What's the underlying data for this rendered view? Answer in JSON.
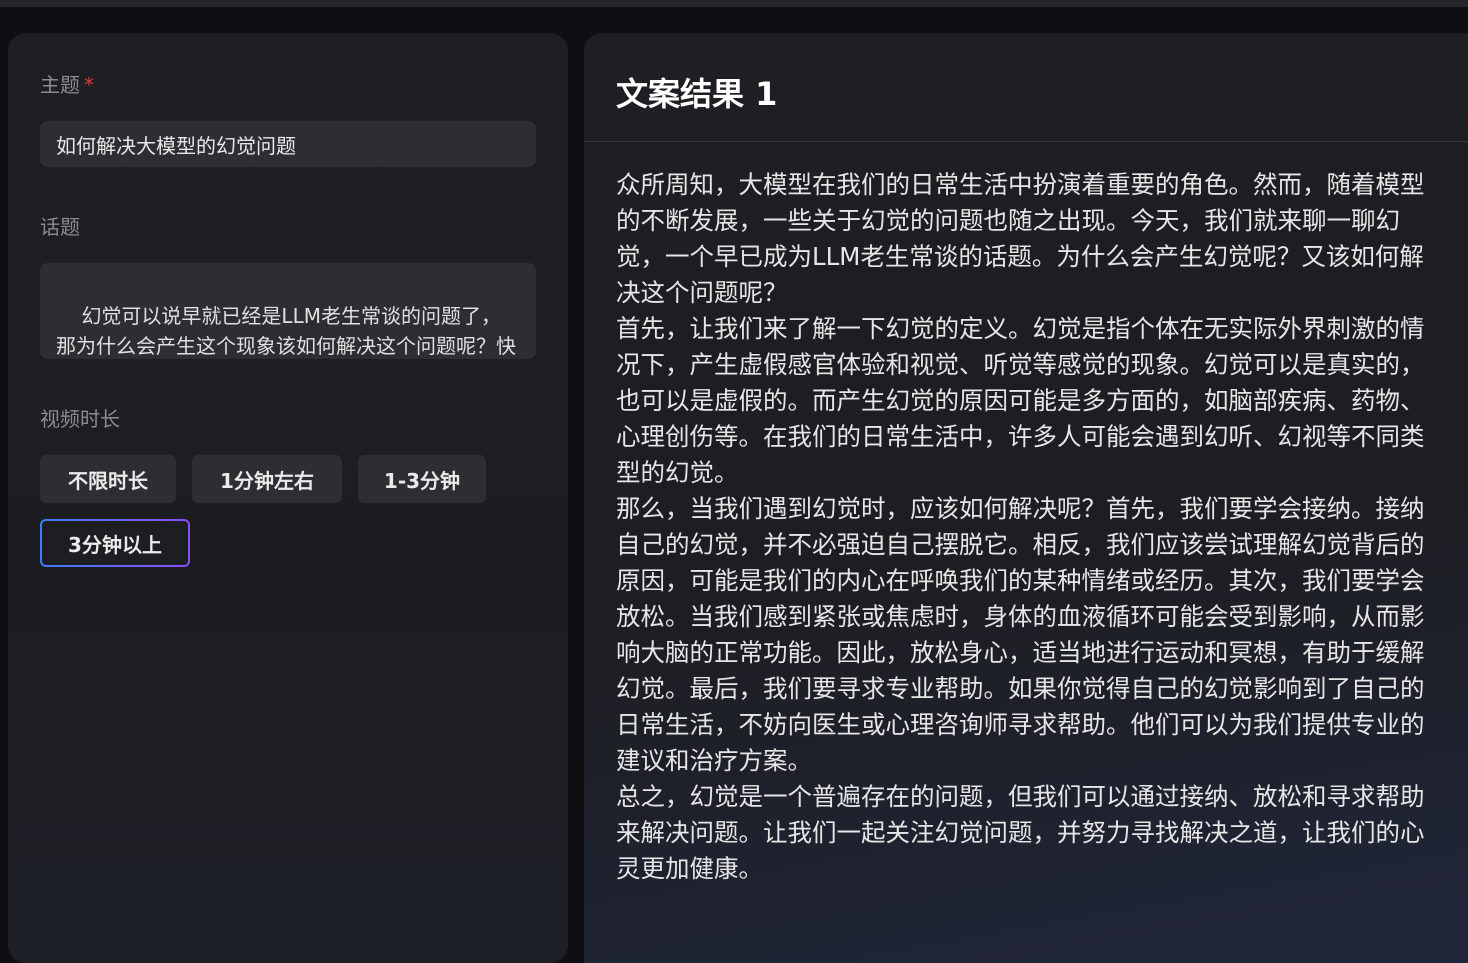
{
  "form": {
    "topic_label": "主题",
    "required_mark": "*",
    "topic_value": "如何解决大模型的幻觉问题",
    "subject_label": "话题",
    "subject_value": "幻觉可以说早就已经是LLM老生常谈的问题了，那为什么会产生这个现象该如何解决这个问题呢？快来和我们分享一下吧~",
    "duration_label": "视频时长",
    "duration_options": [
      "不限时长",
      "1分钟左右",
      "1-3分钟",
      "3分钟以上"
    ],
    "duration_selected": "3分钟以上"
  },
  "result": {
    "title": "文案结果 1",
    "paragraphs": [
      "众所周知，大模型在我们的日常生活中扮演着重要的角色。然而，随着模型的不断发展，一些关于幻觉的问题也随之出现。今天，我们就来聊一聊幻觉，一个早已成为LLM老生常谈的话题。为什么会产生幻觉呢？又该如何解决这个问题呢？",
      "首先，让我们来了解一下幻觉的定义。幻觉是指个体在无实际外界刺激的情况下，产生虚假感官体验和视觉、听觉等感觉的现象。幻觉可以是真实的，也可以是虚假的。而产生幻觉的原因可能是多方面的，如脑部疾病、药物、心理创伤等。在我们的日常生活中，许多人可能会遇到幻听、幻视等不同类型的幻觉。",
      "那么，当我们遇到幻觉时，应该如何解决呢？首先，我们要学会接纳。接纳自己的幻觉，并不必强迫自己摆脱它。相反，我们应该尝试理解幻觉背后的原因，可能是我们的内心在呼唤我们的某种情绪或经历。其次，我们要学会放松。当我们感到紧张或焦虑时，身体的血液循环可能会受到影响，从而影响大脑的正常功能。因此，放松身心，适当地进行运动和冥想，有助于缓解幻觉。最后，我们要寻求专业帮助。如果你觉得自己的幻觉影响到了自己的日常生活，不妨向医生或心理咨询师寻求帮助。他们可以为我们提供专业的建议和治疗方案。",
      "总之，幻觉是一个普遍存在的问题，但我们可以通过接纳、放松和寻求帮助来解决问题。让我们一起关注幻觉问题，并努力寻找解决之道，让我们的心灵更加健康。"
    ]
  },
  "colors": {
    "accent_gradient_start": "#3d7bff",
    "accent_gradient_end": "#8a4cff",
    "required": "#e03a3a"
  }
}
